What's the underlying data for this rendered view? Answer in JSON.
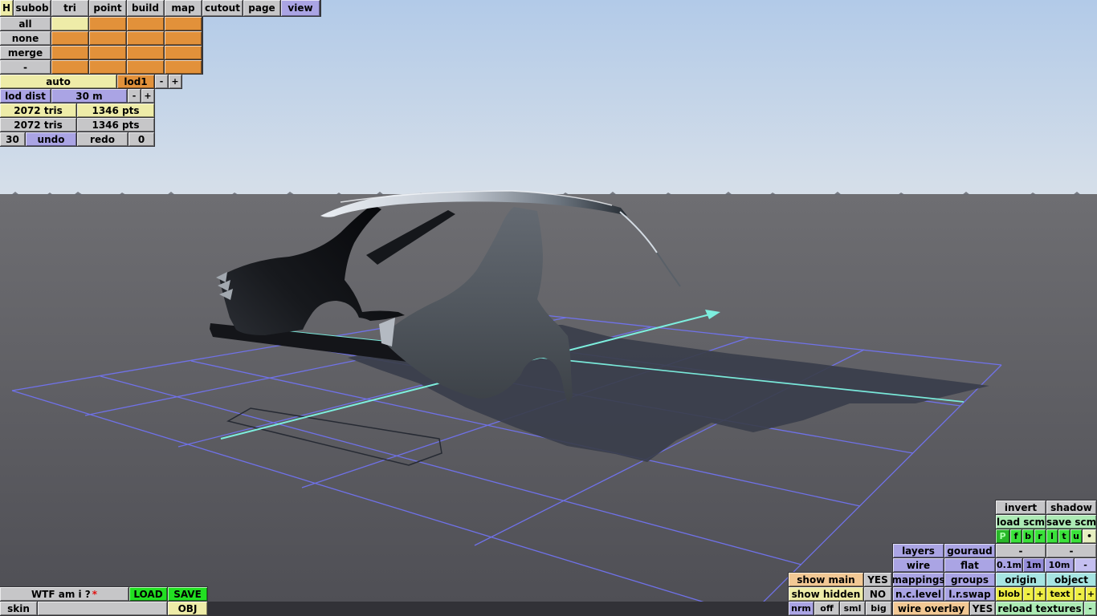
{
  "tabs": {
    "items": [
      "H",
      "subob",
      "tri",
      "point",
      "build",
      "map",
      "cutout",
      "page",
      "view"
    ],
    "active": "view"
  },
  "subob_grid": {
    "row_labels": [
      "all",
      "none",
      "merge",
      "-"
    ],
    "rows": 4,
    "cols": 4,
    "selected_cell": [
      0,
      0
    ]
  },
  "lod_bar": {
    "auto": "auto",
    "lod": "lod1"
  },
  "lod_dist": {
    "label": "lod dist",
    "value": "30 m"
  },
  "stats": {
    "row1": {
      "tris": "2072 tris",
      "pts": "1346 pts"
    },
    "row2": {
      "tris": "2072 tris",
      "pts": "1346 pts"
    }
  },
  "history": {
    "undo_count": "30",
    "undo": "undo",
    "redo": "redo",
    "redo_count": "0"
  },
  "sym": {
    "minus": "-",
    "plus": "+",
    "dot": "•"
  },
  "file_bar": {
    "name": "WTF am i ?",
    "flag": "*",
    "load": "LOAD",
    "save": "SAVE",
    "skin": "skin",
    "skin_value": "",
    "obj": "OBJ"
  },
  "render_panel": {
    "invert": "invert",
    "shadow": "shadow",
    "load_scm": "load scm",
    "save_scm": "save scm",
    "channels": [
      "P",
      "f",
      "b",
      "r",
      "l",
      "t",
      "u"
    ],
    "layers": "layers",
    "gouraud": "gouraud",
    "wire": "wire",
    "flat": "flat",
    "grid_sizes": [
      "0.1m",
      "1m",
      "10m"
    ],
    "grid_size_active": "1m",
    "mappings": "mappings",
    "groups": "groups",
    "origin": "origin",
    "object": "object",
    "nc_level": "n.c.level",
    "lr_swap": "l.r.swap",
    "blob": "blob",
    "text": "text",
    "wire_overlay": "wire overlay",
    "wire_overlay_state": "YES",
    "reload_textures": "reload textures",
    "show_main": "show main",
    "show_main_state": "YES",
    "show_hidden": "show hidden",
    "show_hidden_state": "NO",
    "normals": [
      "nrm",
      "off",
      "sml",
      "big"
    ]
  },
  "viewport": {
    "description": "3D perspective view of a partially modeled car body shell (side panels, roof, pillars) standing on a blue wireframe ground grid with cyan axis lines and a cast shadow",
    "grid_color": "#7173f0",
    "axis_color": "#7deede"
  },
  "colors": {
    "button_gray": "#c6c6c8",
    "pale_yellow": "#eeeca8",
    "orange": "#e2913a",
    "lavender": "#aaa4e4",
    "lavender_active": "#948cd8",
    "bright_green": "#22e022",
    "light_green": "#aceab4",
    "cyan_button": "#a6e4e2",
    "yellow": "#eeee44",
    "tan": "#f2c894",
    "selection_green": "#28b828",
    "sky_top": "#b2cae8",
    "ground": "#56565c"
  }
}
